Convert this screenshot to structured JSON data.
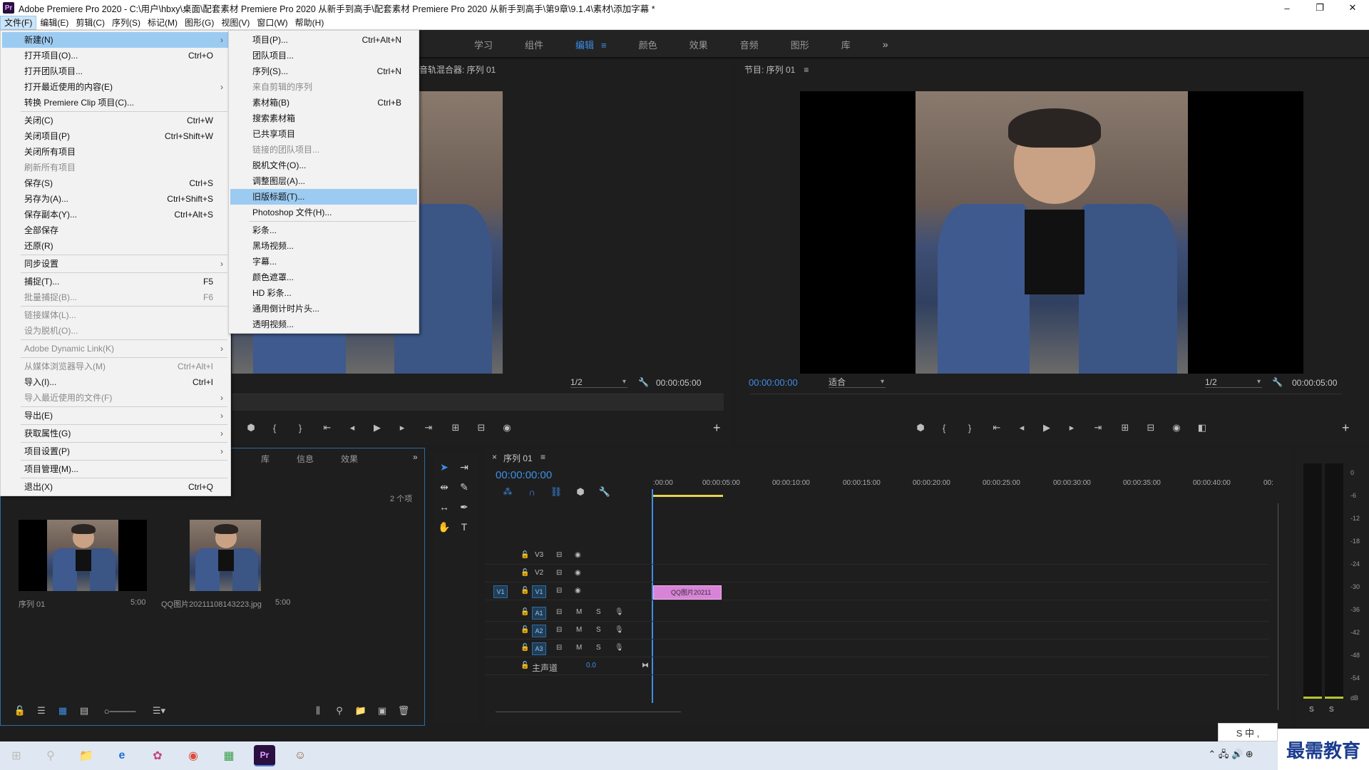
{
  "window": {
    "app_badge": "Pr",
    "title": "Adobe Premiere Pro 2020 - C:\\用户\\hbxy\\桌面\\配套素材 Premiere Pro 2020 从新手到高手\\配套素材 Premiere Pro 2020 从新手到高手\\第9章\\9.1.4\\素材\\添加字幕 *",
    "minimize": "–",
    "maximize": "❐",
    "close": "✕"
  },
  "menubar": [
    {
      "label": "文件(F)",
      "active": true
    },
    {
      "label": "编辑(E)"
    },
    {
      "label": "剪辑(C)"
    },
    {
      "label": "序列(S)"
    },
    {
      "label": "标记(M)"
    },
    {
      "label": "图形(G)"
    },
    {
      "label": "视图(V)"
    },
    {
      "label": "窗口(W)"
    },
    {
      "label": "帮助(H)"
    }
  ],
  "workspaces": {
    "tabs": [
      "学习",
      "组件",
      "编辑",
      "颜色",
      "效果",
      "音频",
      "图形",
      "库"
    ],
    "active": "编辑",
    "active_menu_icon": "≡",
    "more": "»"
  },
  "file_menu": {
    "items": [
      {
        "label": "新建(N)",
        "shortcut": "",
        "submenu": true,
        "highlighted": true
      },
      {
        "label": "打开项目(O)...",
        "shortcut": "Ctrl+O"
      },
      {
        "label": "打开团队项目..."
      },
      {
        "label": "打开最近使用的内容(E)",
        "submenu": true
      },
      {
        "label": "转换 Premiere Clip 项目(C)..."
      },
      {
        "sep": true
      },
      {
        "label": "关闭(C)",
        "shortcut": "Ctrl+W"
      },
      {
        "label": "关闭项目(P)",
        "shortcut": "Ctrl+Shift+W"
      },
      {
        "label": "关闭所有项目"
      },
      {
        "label": "刷新所有项目",
        "disabled": true
      },
      {
        "label": "保存(S)",
        "shortcut": "Ctrl+S"
      },
      {
        "label": "另存为(A)...",
        "shortcut": "Ctrl+Shift+S"
      },
      {
        "label": "保存副本(Y)...",
        "shortcut": "Ctrl+Alt+S"
      },
      {
        "label": "全部保存"
      },
      {
        "label": "还原(R)"
      },
      {
        "sep": true
      },
      {
        "label": "同步设置",
        "submenu": true
      },
      {
        "sep": true
      },
      {
        "label": "捕捉(T)...",
        "shortcut": "F5"
      },
      {
        "label": "批量捕捉(B)...",
        "shortcut": "F6",
        "disabled": true
      },
      {
        "sep": true
      },
      {
        "label": "链接媒体(L)...",
        "disabled": true
      },
      {
        "label": "设为脱机(O)...",
        "disabled": true
      },
      {
        "sep": true
      },
      {
        "label": "Adobe Dynamic Link(K)",
        "submenu": true,
        "disabled": true
      },
      {
        "sep": true
      },
      {
        "label": "从媒体浏览器导入(M)",
        "shortcut": "Ctrl+Alt+I",
        "disabled": true
      },
      {
        "label": "导入(I)...",
        "shortcut": "Ctrl+I"
      },
      {
        "label": "导入最近使用的文件(F)",
        "submenu": true,
        "disabled": true
      },
      {
        "sep": true
      },
      {
        "label": "导出(E)",
        "submenu": true
      },
      {
        "sep": true
      },
      {
        "label": "获取属性(G)",
        "submenu": true
      },
      {
        "sep": true
      },
      {
        "label": "项目设置(P)",
        "submenu": true
      },
      {
        "sep": true
      },
      {
        "label": "项目管理(M)..."
      },
      {
        "sep": true
      },
      {
        "label": "退出(X)",
        "shortcut": "Ctrl+Q"
      }
    ]
  },
  "new_submenu": {
    "items": [
      {
        "label": "项目(P)...",
        "shortcut": "Ctrl+Alt+N"
      },
      {
        "label": "团队项目..."
      },
      {
        "label": "序列(S)...",
        "shortcut": "Ctrl+N"
      },
      {
        "label": "来自剪辑的序列",
        "disabled": true
      },
      {
        "label": "素材箱(B)",
        "shortcut": "Ctrl+B"
      },
      {
        "label": "搜索素材箱"
      },
      {
        "label": "已共享项目"
      },
      {
        "label": "链接的团队项目...",
        "disabled": true
      },
      {
        "label": "脱机文件(O)..."
      },
      {
        "label": "调整图层(A)..."
      },
      {
        "label": "旧版标题(T)...",
        "highlighted": true
      },
      {
        "label": "Photoshop 文件(H)..."
      },
      {
        "sep": true
      },
      {
        "label": "彩条..."
      },
      {
        "label": "黑场视频..."
      },
      {
        "label": "字幕..."
      },
      {
        "label": "颜色遮罩..."
      },
      {
        "label": "HD 彩条..."
      },
      {
        "label": "通用倒计时片头..."
      },
      {
        "label": "透明视频..."
      }
    ]
  },
  "source_monitor": {
    "header": "音轨混合器: 序列 01",
    "resolution": "1/2",
    "duration": "00:00:05:00"
  },
  "program_monitor": {
    "header": "节目: 序列 01",
    "header_menu": "≡",
    "timecode": "00:00:00:00",
    "fit": "适合",
    "resolution": "1/2",
    "duration": "00:00:05:00"
  },
  "project_panel": {
    "tabs": [
      "库",
      "信息",
      "效果"
    ],
    "more": "»",
    "count": "2 个项",
    "items": [
      {
        "name": "序列 01",
        "duration": "5:00"
      },
      {
        "name": "QQ图片20211108143223.jpg",
        "duration": "5:00"
      }
    ]
  },
  "timeline": {
    "close": "×",
    "tab": "序列 01",
    "tab_menu": "≡",
    "timecode": "00:00:00:00",
    "ticks": [
      ":00:00",
      "00:00:05:00",
      "00:00:10:00",
      "00:00:15:00",
      "00:00:20:00",
      "00:00:25:00",
      "00:00:30:00",
      "00:00:35:00",
      "00:00:40:00",
      "00:"
    ],
    "video_tracks": [
      "V3",
      "V2",
      "V1"
    ],
    "audio_tracks": [
      "A1",
      "A2",
      "A3"
    ],
    "source_patch": "V1",
    "master": {
      "label": "主声道",
      "value": "0.0"
    },
    "clip_label": "QQ图片20211",
    "mute_label": "M",
    "solo_label": "S"
  },
  "meters": {
    "scale": [
      "0",
      "-6",
      "-12",
      "-18",
      "-24",
      "-30",
      "-36",
      "-42",
      "-48",
      "-54",
      "dB"
    ],
    "solo": [
      "S",
      "S"
    ]
  },
  "tools": [
    {
      "icon": "selection-tool-icon",
      "glyph": "➤"
    },
    {
      "icon": "track-select-icon",
      "glyph": "⇥"
    },
    {
      "icon": "ripple-edit-icon",
      "glyph": "⇹"
    },
    {
      "icon": "razor-icon",
      "glyph": "✎"
    },
    {
      "icon": "slip-icon",
      "glyph": "↔"
    },
    {
      "icon": "pen-icon",
      "glyph": "✒"
    },
    {
      "icon": "hand-icon",
      "glyph": "✋"
    },
    {
      "icon": "type-tool-icon",
      "glyph": "T"
    }
  ],
  "taskbar": {
    "ime_text": "S 中 ,",
    "watermark": "最需教育",
    "apps": [
      "⊞",
      "⚲",
      "📁",
      "e",
      "✿",
      "◉",
      "▦",
      "Pr",
      "☺"
    ]
  }
}
